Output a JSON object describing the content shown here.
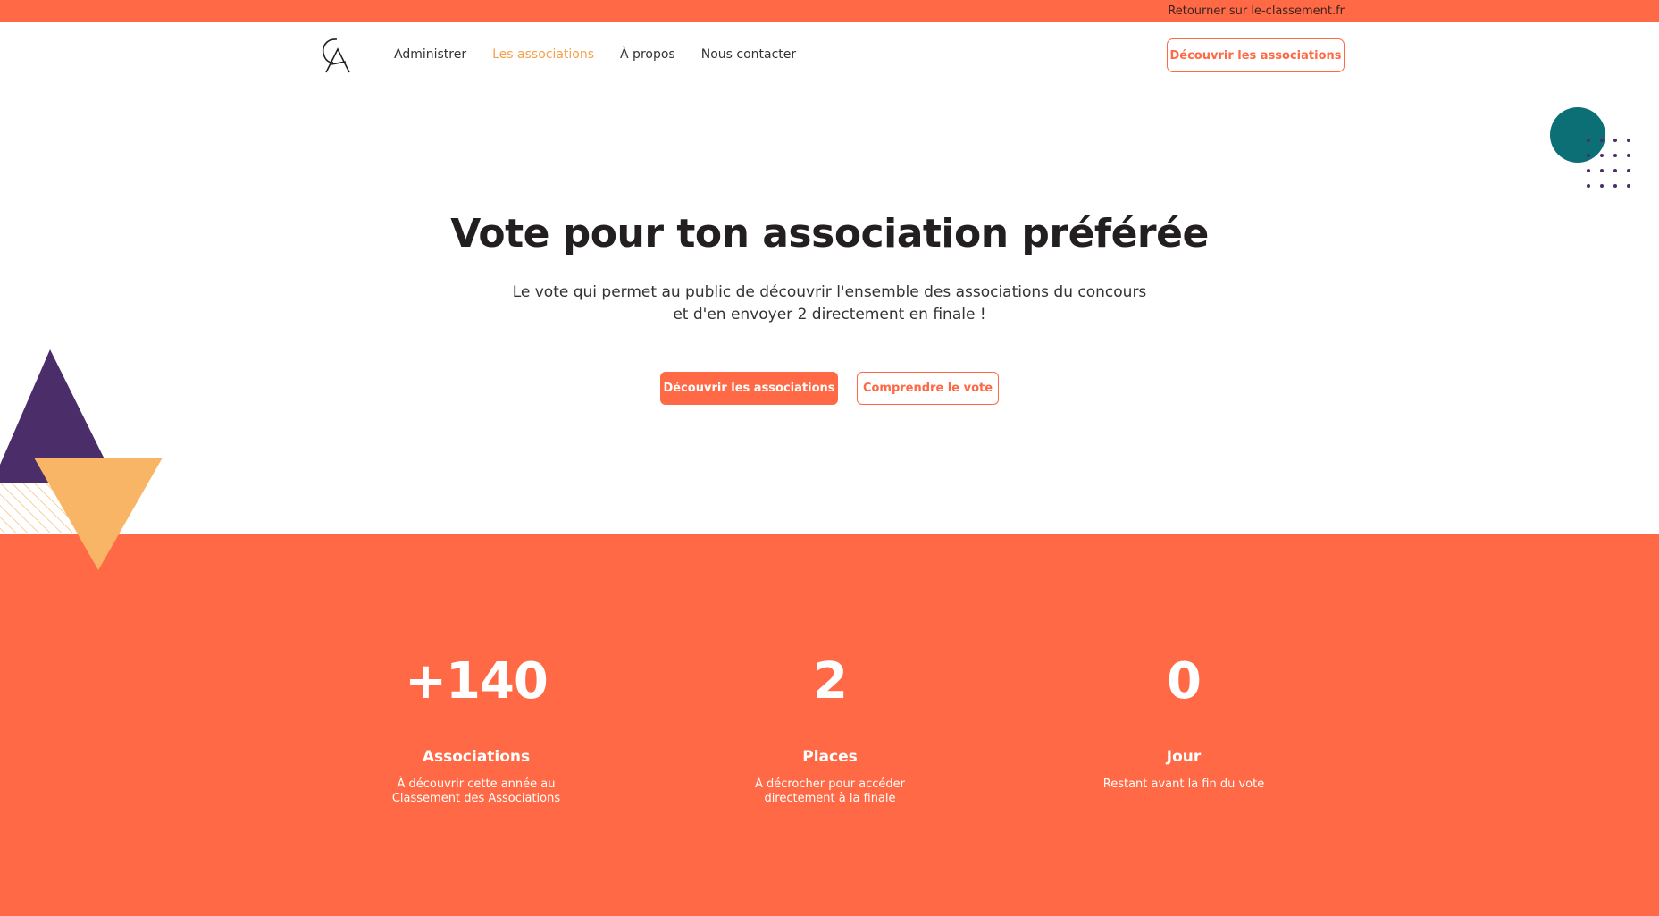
{
  "topbar": {
    "link": "Retourner sur le-classement.fr"
  },
  "nav": {
    "items": [
      {
        "label": "Administrer"
      },
      {
        "label": "Les associations"
      },
      {
        "label": "À propos"
      },
      {
        "label": "Nous contacter"
      }
    ],
    "active_index": 1,
    "cta": "Découvrir les associations"
  },
  "hero": {
    "title": "Vote pour ton association préférée",
    "subtitle_line1": "Le vote qui permet au public de découvrir l'ensemble des associations du concours",
    "subtitle_line2": "et d'en envoyer 2 directement en finale !",
    "primary_button": "Découvrir les associations",
    "secondary_button": "Comprendre le vote"
  },
  "stats": [
    {
      "value": "+140",
      "label": "Associations",
      "desc_line1": "À découvrir cette année au",
      "desc_line2": "Classement des Associations"
    },
    {
      "value": "2",
      "label": "Places",
      "desc_line1": "À décrocher pour accéder",
      "desc_line2": "directement à la finale"
    },
    {
      "value": "0",
      "label": "Jour",
      "desc_line1": "Restant avant la fin du vote",
      "desc_line2": ""
    }
  ],
  "colors": {
    "brand": "#ff6945",
    "nav_active": "#f5a04a",
    "purple": "#4b2d6a",
    "yellow": "#f8b565",
    "teal": "#0c6f76"
  },
  "icons": {
    "logo": "ca-monogram-logo"
  }
}
